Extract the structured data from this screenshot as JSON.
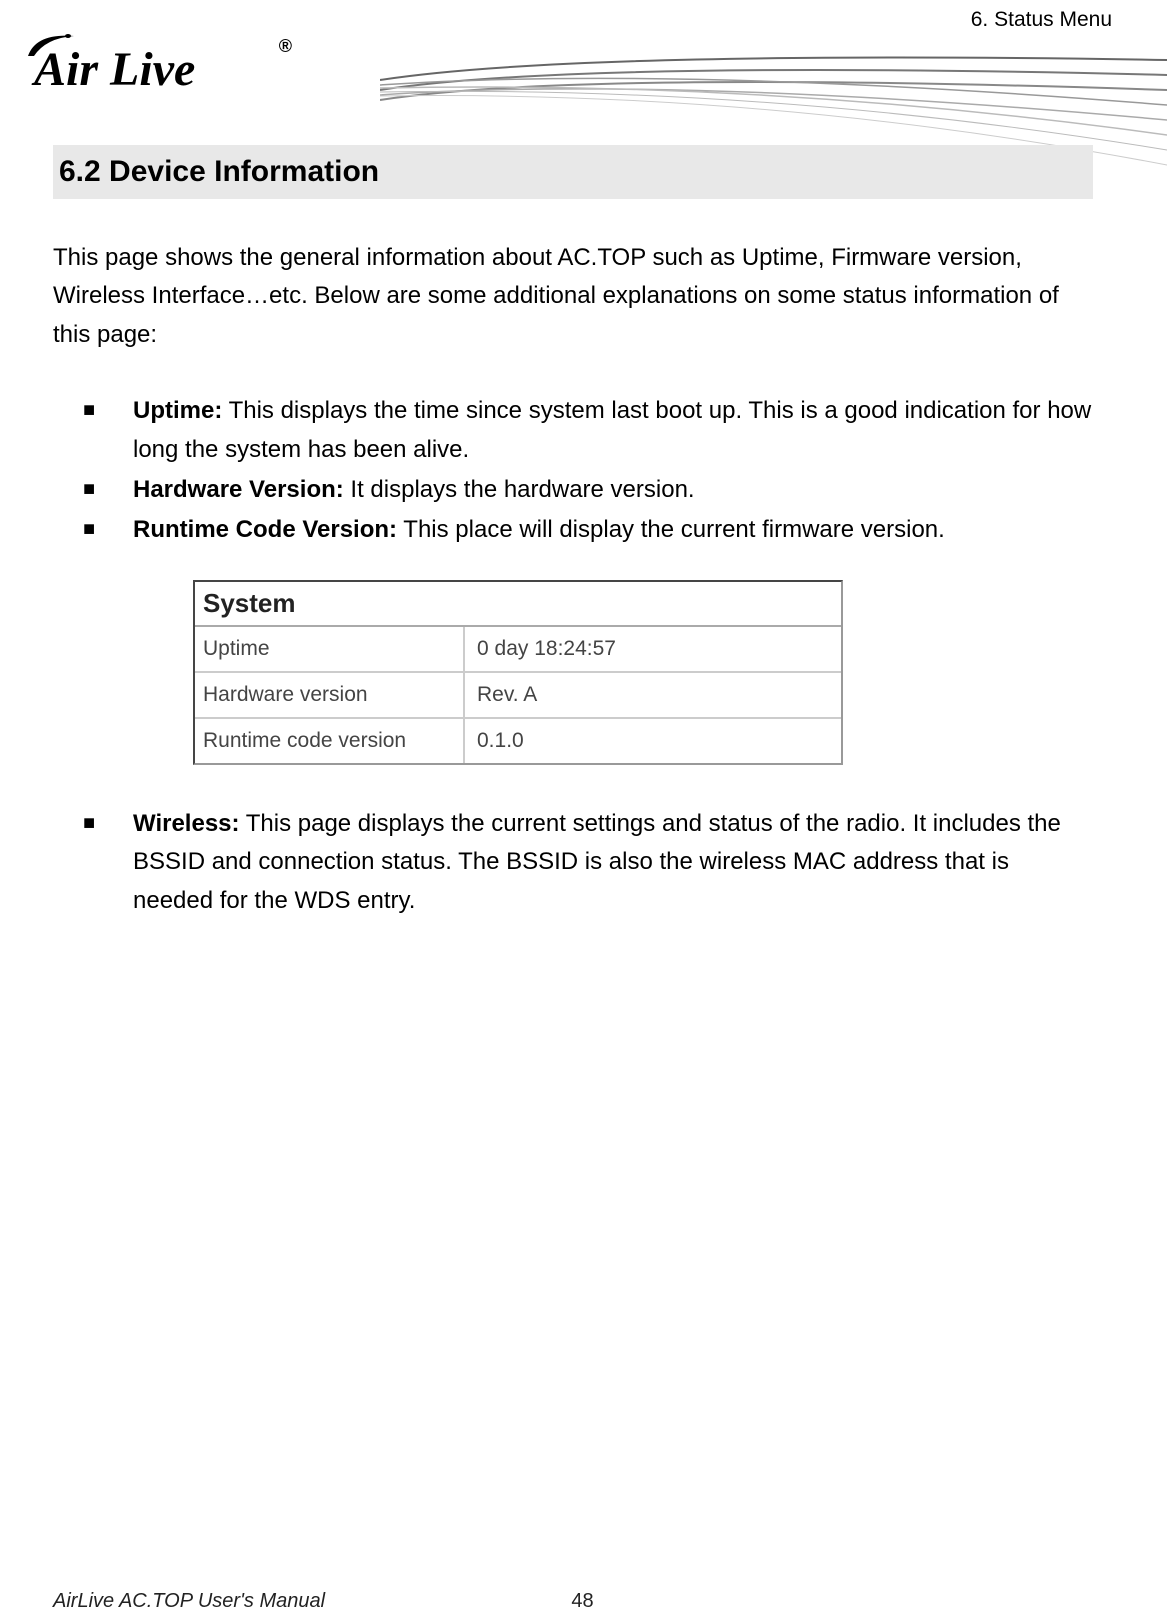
{
  "header": {
    "chapter": "6. Status Menu",
    "logo_text": "Air Live"
  },
  "section": {
    "heading": "6.2 Device Information",
    "intro": "This page shows the general information about AC.TOP such as Uptime, Firmware version, Wireless Interface…etc.   Below are some additional explanations on some status information of this page:"
  },
  "bullets1": [
    {
      "title": "Uptime:",
      "text": " This displays the time since system last boot up.   This is a good indication for how long the system has been alive."
    },
    {
      "title": "Hardware Version:",
      "text": " It displays the hardware version."
    },
    {
      "title": "Runtime Code Version:",
      "text": " This place will display the current firmware version."
    }
  ],
  "system_table": {
    "header": "System",
    "rows": [
      {
        "label": "Uptime",
        "value": "0 day 18:24:57"
      },
      {
        "label": "Hardware version",
        "value": "Rev. A"
      },
      {
        "label": "Runtime code version",
        "value": "0.1.0"
      }
    ]
  },
  "bullets2": [
    {
      "title": "Wireless:",
      "text": " This page displays the current settings and status of the radio. It includes the BSSID and connection status. The BSSID is also the wireless MAC address that is needed for the WDS entry."
    }
  ],
  "footer": {
    "manual": "AirLive AC.TOP User's Manual",
    "page": "48"
  }
}
